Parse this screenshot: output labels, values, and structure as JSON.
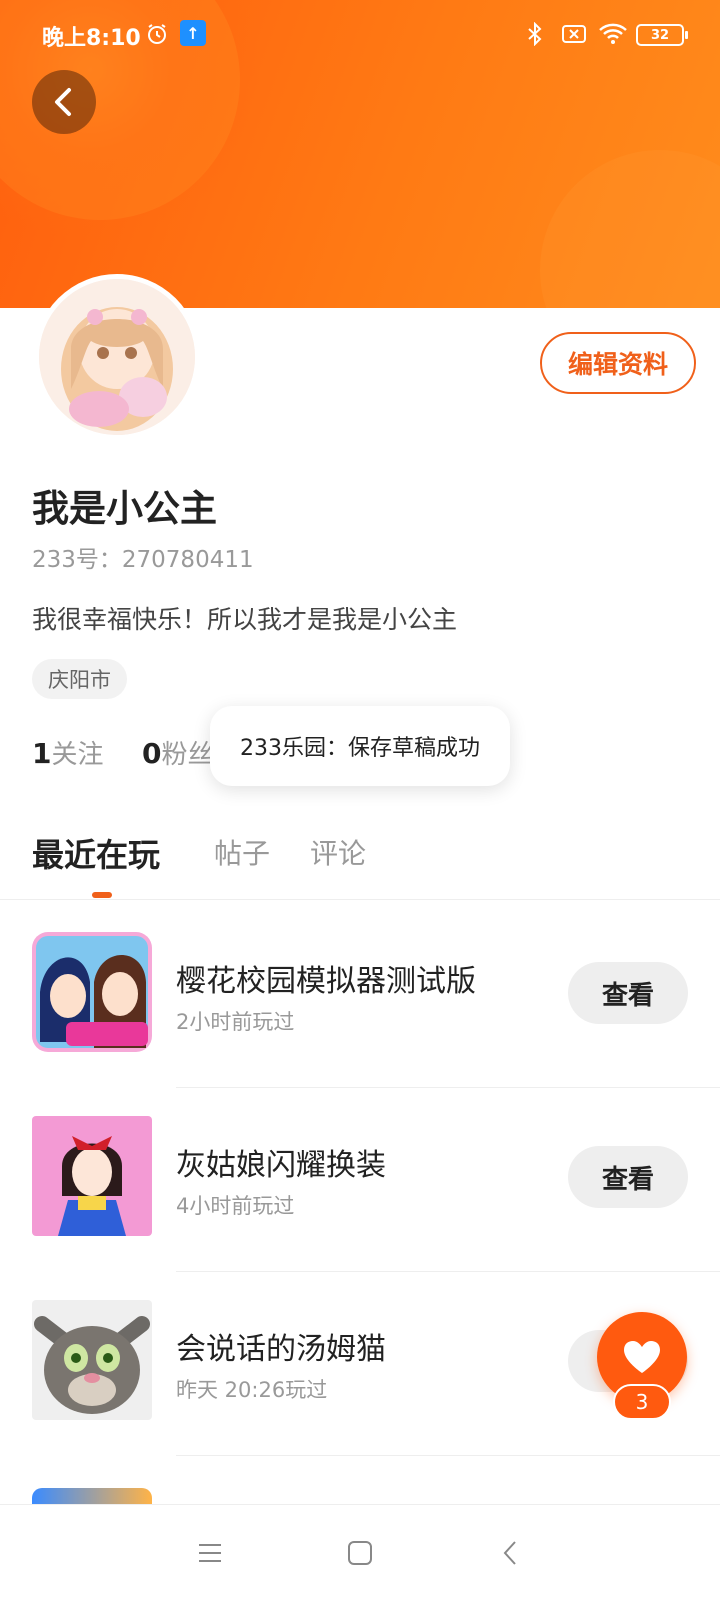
{
  "status_bar": {
    "time": "晚上8:10",
    "battery": "32"
  },
  "profile": {
    "username": "我是小公主",
    "user_id": "233号：270780411",
    "bio": "我很幸福快乐！所以我才是我是小公主",
    "location": "庆阳市",
    "edit_button": "编辑资料"
  },
  "stats": {
    "following_count": "1",
    "following_label": "关注",
    "fans_count": "0",
    "fans_label": "粉丝"
  },
  "toast": {
    "text": "233乐园：保存草稿成功"
  },
  "tabs": [
    {
      "label": "最近在玩",
      "active": true
    },
    {
      "label": "帖子",
      "active": false
    },
    {
      "label": "评论",
      "active": false
    }
  ],
  "games": [
    {
      "name": "樱花校园模拟器测试版",
      "time": "2小时前玩过",
      "button": "查看"
    },
    {
      "name": "灰姑娘闪耀换装",
      "time": "4小时前玩过",
      "button": "查看"
    },
    {
      "name": "会说话的汤姆猫",
      "time": "昨天 20:26玩过",
      "button": "查看"
    }
  ],
  "like_fab": {
    "count": "3"
  },
  "colors": {
    "accent": "#f0601a",
    "header": "#ff7a14"
  }
}
